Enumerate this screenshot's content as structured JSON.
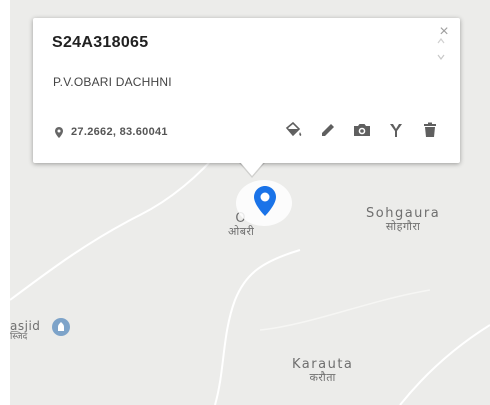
{
  "popup": {
    "station_id": "S24A318065",
    "station_name": "P.V.OBARI DACHHNI",
    "coordinates": "27.2662, 83.60041",
    "close_symbol": "×",
    "actions": [
      "paint-bucket-icon",
      "pencil-icon",
      "camera-icon",
      "fork-icon",
      "trash-icon"
    ]
  },
  "map": {
    "places": {
      "obari_en": "O",
      "obari_hi": "ओबरी",
      "sohgaura_en": "Sohgaura",
      "sohgaura_hi": "सोहगौरा",
      "karauta_en": "Karauta",
      "karauta_hi": "करौता",
      "masjid_en": "asjid",
      "masjid_hi": "स्जिद"
    },
    "marker_color": "#1a73e8",
    "background_color": "#ececea"
  }
}
